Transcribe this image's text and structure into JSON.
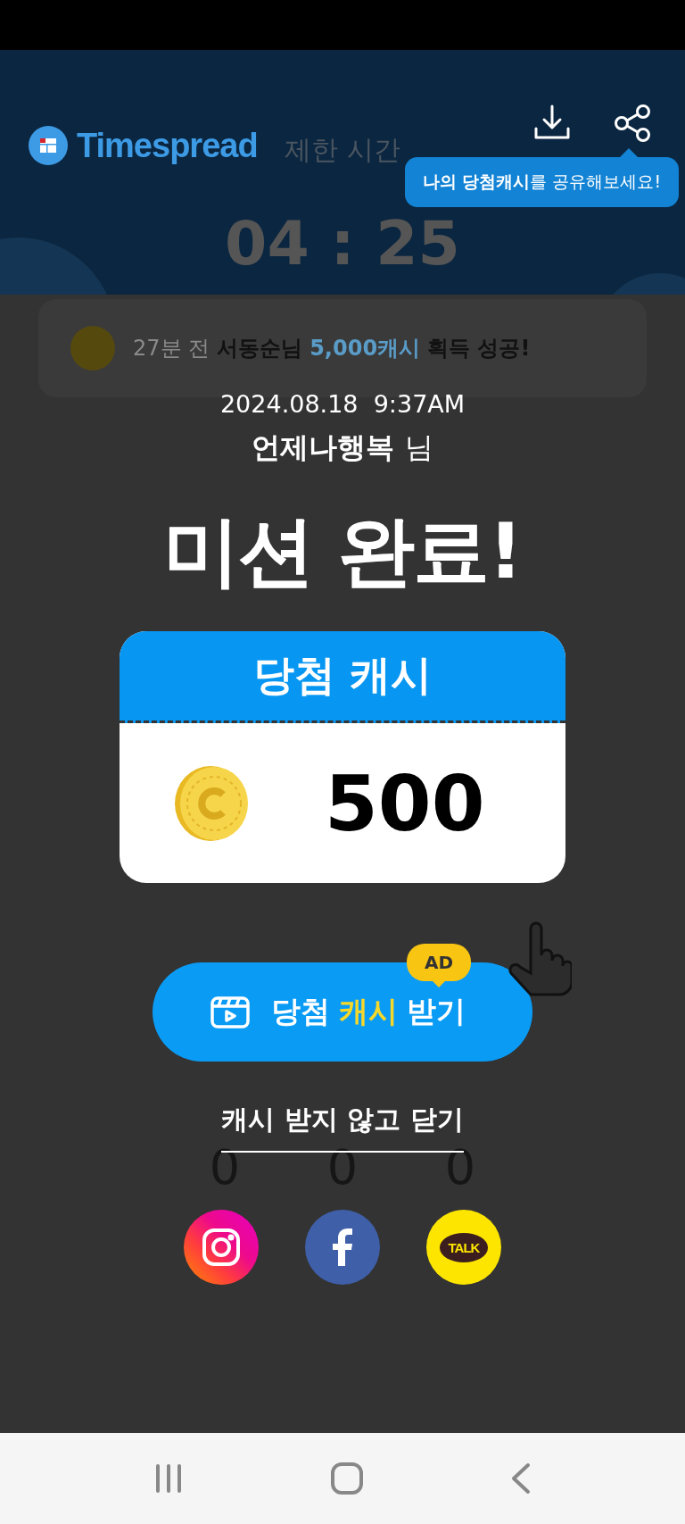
{
  "header": {
    "logo": "Timespread",
    "tooltip": "**나의 당첨캐시**를 공유해보세요!"
  },
  "background": {
    "timer_label": "제한 시간",
    "timer": "04 : 25",
    "ticker": [
      {
        "kind": "time",
        "text": "27분 전"
      },
      {
        "kind": "name",
        "text": "서동순님"
      },
      {
        "kind": "amount",
        "text": "5,000캐시"
      },
      {
        "kind": "plain",
        "text": "획득 성공!"
      }
    ],
    "digits": [
      "0",
      "0",
      "0"
    ]
  },
  "modal": {
    "datetime": "2024.08.18  9:37AM",
    "nickname": "언제나행복",
    "honorific": "님",
    "title": "미션 완료!",
    "prize_card": {
      "title": "당첨 캐시",
      "amount": "500"
    },
    "claim_button": {
      "badge": "AD",
      "parts": [
        {
          "text": "당첨",
          "highlight": false
        },
        {
          "text": "캐시",
          "highlight": true
        },
        {
          "text": "받기",
          "highlight": false
        }
      ]
    },
    "close_link": "캐시 받지 않고 닫기",
    "share": [
      {
        "kind": "instagram"
      },
      {
        "kind": "facebook"
      },
      {
        "kind": "kakaotalk",
        "label": "TALK"
      }
    ]
  }
}
